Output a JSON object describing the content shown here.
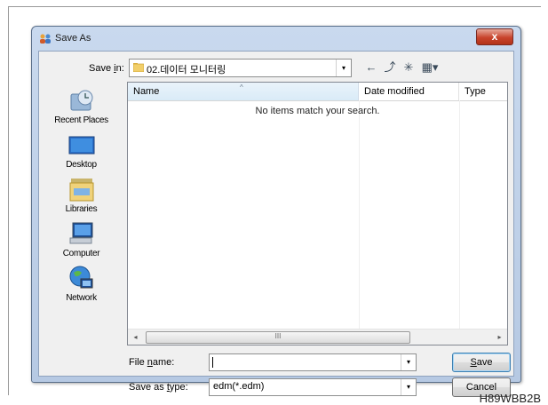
{
  "window": {
    "title": "Save As",
    "close_label": "x",
    "app_icon": "people-app-icon"
  },
  "savein": {
    "label_prefix": "Save ",
    "label_access": "i",
    "label_suffix": "n:",
    "value": "02.데이터 모니터링",
    "dropdown_icon": "▾"
  },
  "toolbar": {
    "back_icon": "←",
    "up_icon": "⤴",
    "new_folder_icon": "✳",
    "views_icon": "▦▾"
  },
  "places": [
    {
      "label": "Recent Places",
      "icon": "recent-places-icon"
    },
    {
      "label": "Desktop",
      "icon": "desktop-icon"
    },
    {
      "label": "Libraries",
      "icon": "libraries-icon"
    },
    {
      "label": "Computer",
      "icon": "computer-icon"
    },
    {
      "label": "Network",
      "icon": "network-icon"
    }
  ],
  "filelist": {
    "columns": [
      "Name",
      "Date modified",
      "Type"
    ],
    "sort_indicator": "^",
    "empty_message": "No items match your search.",
    "scroll_left": "◂",
    "scroll_right": "▸",
    "scroll_grip": "III"
  },
  "filename": {
    "label_prefix": "File ",
    "label_access": "n",
    "label_suffix": "ame:",
    "value": ""
  },
  "savetype": {
    "label_prefix": "Save as ",
    "label_access": "t",
    "label_suffix": "ype:",
    "value": "edm(*.edm)"
  },
  "buttons": {
    "save_access": "S",
    "save_rest": "ave",
    "cancel": "Cancel"
  },
  "figure_code": "H89WBB2B",
  "colors": {
    "title_gradient": "#c9d9ee",
    "close_red": "#c8442c",
    "list_header_highlight": "#d9ebf7"
  }
}
